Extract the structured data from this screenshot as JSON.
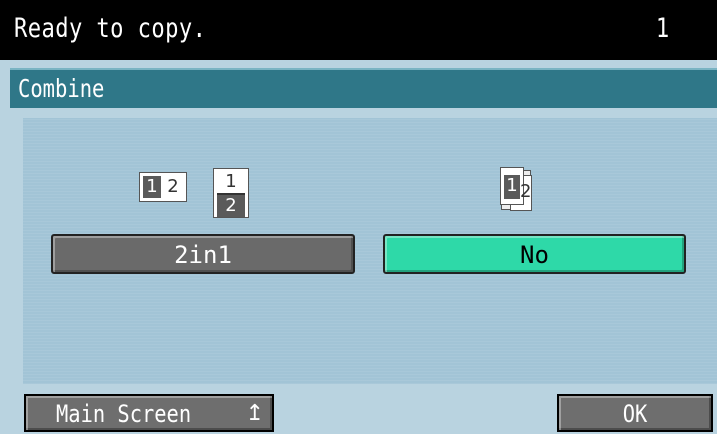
{
  "status": {
    "message": "Ready to copy.",
    "copies": "1"
  },
  "screen": {
    "title": "Combine"
  },
  "options": [
    {
      "label": "2in1",
      "icon": "two-in-one-icon",
      "selected": false
    },
    {
      "label": "No",
      "icon": "no-combine-icon",
      "selected": true
    }
  ],
  "icon_digits": {
    "one": "1",
    "two": "2"
  },
  "footer": {
    "main_screen": "Main Screen",
    "ok": "OK"
  },
  "colors": {
    "selected": "#2ed9a8",
    "title_bar": "#2f7788",
    "status_bar": "#000000",
    "button": "#6a6a6a"
  }
}
